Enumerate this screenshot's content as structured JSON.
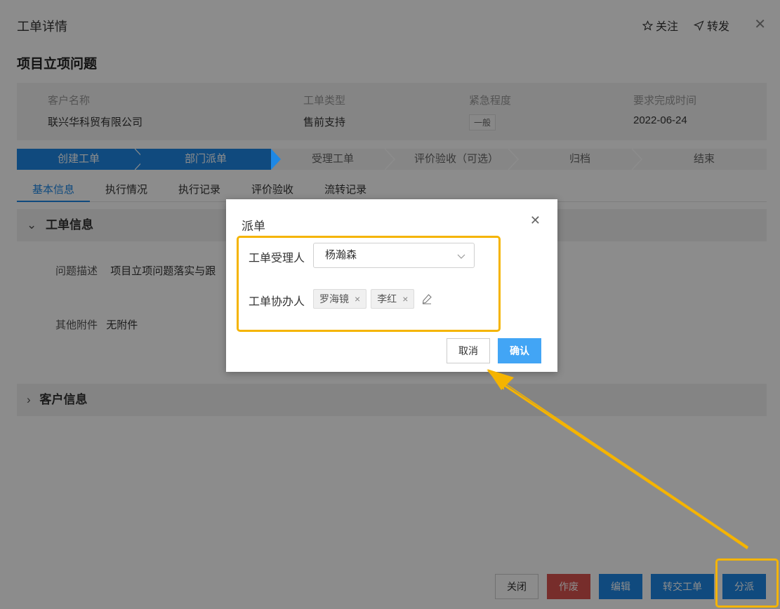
{
  "window": {
    "title": "工单详情",
    "follow_label": "关注",
    "forward_label": "转发",
    "close_glyph": "✕"
  },
  "ticket": {
    "title": "项目立项问题",
    "fields": [
      {
        "label": "客户名称",
        "value": "联兴华科贸有限公司"
      },
      {
        "label": "工单类型",
        "value": "售前支持"
      },
      {
        "label": "紧急程度",
        "value": "一般"
      },
      {
        "label": "要求完成时间",
        "value": "2022-06-24"
      }
    ]
  },
  "steps": [
    {
      "label": "创建工单",
      "active": true
    },
    {
      "label": "部门派单",
      "active": true
    },
    {
      "label": "受理工单",
      "active": false
    },
    {
      "label": "评价验收（可选）",
      "active": false
    },
    {
      "label": "归档",
      "active": false
    },
    {
      "label": "结束",
      "active": false
    }
  ],
  "tabs": [
    {
      "label": "基本信息",
      "active": true
    },
    {
      "label": "执行情况",
      "active": false
    },
    {
      "label": "执行记录",
      "active": false
    },
    {
      "label": "评价验收",
      "active": false
    },
    {
      "label": "流转记录",
      "active": false
    }
  ],
  "sections": {
    "ticket_info": {
      "title": "工单信息",
      "chevron": "⌄"
    },
    "customer_info": {
      "title": "客户信息",
      "chevron": "›"
    }
  },
  "details": {
    "problem_label": "问题描述",
    "problem_value": "项目立项问题落实与跟",
    "attachment_label": "其他附件",
    "attachment_value": "无附件"
  },
  "footer": {
    "close_label": "关闭",
    "void_label": "作废",
    "edit_label": "编辑",
    "transfer_label": "转交工单",
    "dispatch_label": "分派"
  },
  "modal": {
    "title": "派单",
    "close_glyph": "✕",
    "assignee_label": "工单受理人",
    "assignee_value": "杨瀚森",
    "co_handler_label": "工单协办人",
    "co_handlers": [
      "罗海镜",
      "李红"
    ],
    "chip_remove_glyph": "×",
    "cancel_label": "取消",
    "confirm_label": "确认"
  },
  "colors": {
    "primary": "#1e88e5",
    "danger": "#d9534f",
    "highlight": "#f5b400"
  }
}
